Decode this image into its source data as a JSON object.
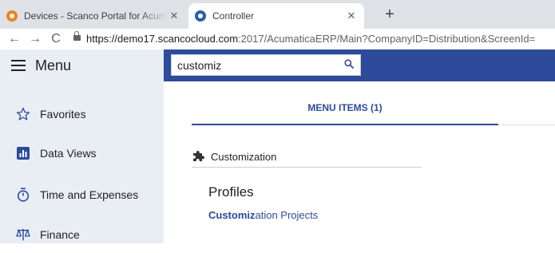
{
  "browser": {
    "tabs": [
      {
        "title": "Devices - Scanco Portal for Acumatica",
        "favicon_color": "#f0821e",
        "close": "✕"
      },
      {
        "title": "Controller",
        "favicon_color": "#2d5ea8",
        "close": "✕"
      }
    ],
    "new_tab": "+",
    "url_host": "https://demo17.scancocloud.com",
    "url_rest": ":2017/AcumaticaERP/Main?CompanyID=Distribution&ScreenId=",
    "back": "←",
    "forward": "→",
    "reload": "C"
  },
  "header": {
    "menu_title": "Menu",
    "search_value": "customiz",
    "accent": "#2d4b9a"
  },
  "sidebar": {
    "items": [
      {
        "label": "Favorites",
        "icon": "star-icon"
      },
      {
        "label": "Data Views",
        "icon": "chart-icon"
      },
      {
        "label": "Time and Expenses",
        "icon": "stopwatch-icon"
      },
      {
        "label": "Finance",
        "icon": "scales-icon"
      }
    ]
  },
  "main": {
    "tab_label": "MENU ITEMS (1)",
    "section_title": "Customization",
    "group_title": "Profiles",
    "result": {
      "match": "Customiz",
      "rest": "ation Projects"
    }
  }
}
